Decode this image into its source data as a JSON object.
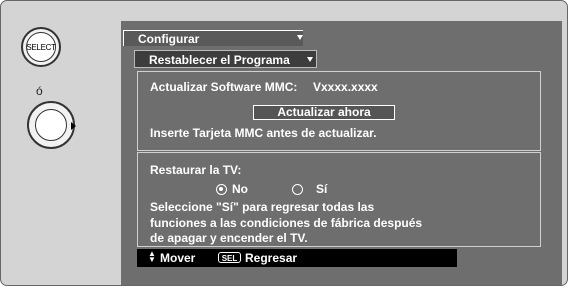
{
  "remote": {
    "select_label": "SELECT",
    "or_text": "ó"
  },
  "menu": {
    "config_tab": "Configurar",
    "reset_tab": "Restablecer el Programa"
  },
  "mmc": {
    "version_label": "Actualizar Software MMC:",
    "version_value": "Vxxxx.xxxx",
    "update_button": "Actualizar ahora",
    "instruction": "Inserte Tarjeta MMC antes de actualizar."
  },
  "restore": {
    "title": "Restaurar la TV:",
    "option_no": "No",
    "option_yes": "Sí",
    "selected": "No",
    "description_line1": "Seleccione \"Sí\" para regresar todas las",
    "description_line2": "funciones a las condiciones de fábrica después",
    "description_line3": "de apagar y encender el TV."
  },
  "footer": {
    "move_label": "Mover",
    "sel_icon": "SEL",
    "back_label": "Regresar"
  }
}
